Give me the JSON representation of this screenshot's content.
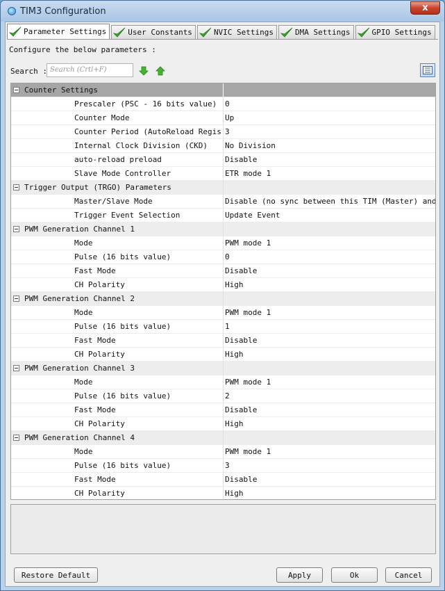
{
  "window": {
    "title": "TIM3 Configuration",
    "close_label": "x"
  },
  "tabs": [
    {
      "label": "Parameter Settings",
      "active": true
    },
    {
      "label": "User Constants",
      "active": false
    },
    {
      "label": "NVIC Settings",
      "active": false
    },
    {
      "label": "DMA Settings",
      "active": false
    },
    {
      "label": "GPIO Settings",
      "active": false
    }
  ],
  "configure_label": "Configure the below parameters :",
  "search": {
    "label": "Search :",
    "placeholder": "Search (Crtl+F)"
  },
  "groups": [
    {
      "title": "Counter Settings",
      "selected": true,
      "params": [
        {
          "name": "Prescaler (PSC - 16 bits value)",
          "value": "0"
        },
        {
          "name": "Counter Mode",
          "value": "Up"
        },
        {
          "name": "Counter Period (AutoReload Regis...",
          "value": "3"
        },
        {
          "name": "Internal Clock Division (CKD)",
          "value": "No Division"
        },
        {
          "name": "auto-reload preload",
          "value": "Disable"
        },
        {
          "name": "Slave Mode Controller",
          "value": "ETR mode 1"
        }
      ]
    },
    {
      "title": "Trigger Output (TRGO) Parameters",
      "selected": false,
      "params": [
        {
          "name": "Master/Slave Mode",
          "value": "Disable (no sync between this TIM (Master) and ..."
        },
        {
          "name": "Trigger Event Selection",
          "value": "Update Event"
        }
      ]
    },
    {
      "title": "PWM Generation Channel 1",
      "selected": false,
      "params": [
        {
          "name": "Mode",
          "value": "PWM mode 1"
        },
        {
          "name": "Pulse (16 bits value)",
          "value": "0"
        },
        {
          "name": "Fast Mode",
          "value": "Disable"
        },
        {
          "name": "CH Polarity",
          "value": "High"
        }
      ]
    },
    {
      "title": "PWM Generation Channel 2",
      "selected": false,
      "params": [
        {
          "name": "Mode",
          "value": "PWM mode 1"
        },
        {
          "name": "Pulse (16 bits value)",
          "value": "1"
        },
        {
          "name": "Fast Mode",
          "value": "Disable"
        },
        {
          "name": "CH Polarity",
          "value": "High"
        }
      ]
    },
    {
      "title": "PWM Generation Channel 3",
      "selected": false,
      "params": [
        {
          "name": "Mode",
          "value": "PWM mode 1"
        },
        {
          "name": "Pulse (16 bits value)",
          "value": "2"
        },
        {
          "name": "Fast Mode",
          "value": "Disable"
        },
        {
          "name": "CH Polarity",
          "value": "High"
        }
      ]
    },
    {
      "title": "PWM Generation Channel 4",
      "selected": false,
      "params": [
        {
          "name": "Mode",
          "value": "PWM mode 1"
        },
        {
          "name": "Pulse (16 bits value)",
          "value": "3"
        },
        {
          "name": "Fast Mode",
          "value": "Disable"
        },
        {
          "name": "CH Polarity",
          "value": "High"
        }
      ]
    }
  ],
  "buttons": {
    "restore_default": "Restore Default",
    "apply": "Apply",
    "ok": "Ok",
    "cancel": "Cancel"
  },
  "icons": {
    "tab_check": "check-icon",
    "search_next": "arrow-down-icon",
    "search_prev": "arrow-up-icon",
    "view_toggle": "list-view-icon",
    "collapse": "collapse-icon"
  },
  "colors": {
    "selected_group": "#a6a6a6",
    "check_green": "#3aa52a"
  }
}
